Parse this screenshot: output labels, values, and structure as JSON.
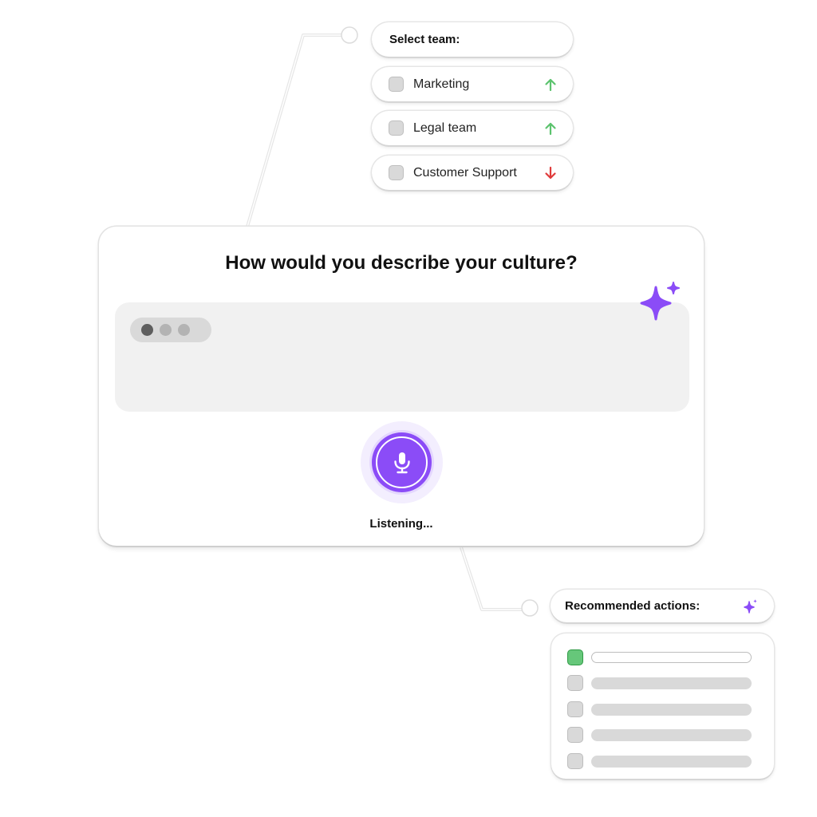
{
  "team_selector": {
    "header": "Select team:",
    "items": [
      {
        "label": "Marketing",
        "trend": "up",
        "trend_icon": "arrow-up-icon",
        "checked": false
      },
      {
        "label": "Legal team",
        "trend": "up",
        "trend_icon": "arrow-up-icon",
        "checked": false
      },
      {
        "label": "Customer Support",
        "trend": "down",
        "trend_icon": "arrow-down-icon",
        "checked": false
      }
    ]
  },
  "survey_card": {
    "question": "How would you describe your culture?",
    "answer_state": "typing",
    "sparkle_icon": "sparkle-icon",
    "mic_icon": "microphone-icon",
    "status": "Listening..."
  },
  "recommendations": {
    "header": "Recommended actions:",
    "header_icon": "sparkle-icon",
    "items": [
      {
        "checked": true,
        "placeholder": true
      },
      {
        "checked": false,
        "placeholder": true
      },
      {
        "checked": false,
        "placeholder": true
      },
      {
        "checked": false,
        "placeholder": true
      },
      {
        "checked": false,
        "placeholder": true
      }
    ]
  },
  "colors": {
    "accent_purple": "#8b4cf7",
    "trend_up": "#5cc36e",
    "trend_down": "#e03b3b",
    "checked_green": "#66c77a",
    "placeholder_gray": "#d9d9d9",
    "answer_bg": "#f1f1f1"
  }
}
